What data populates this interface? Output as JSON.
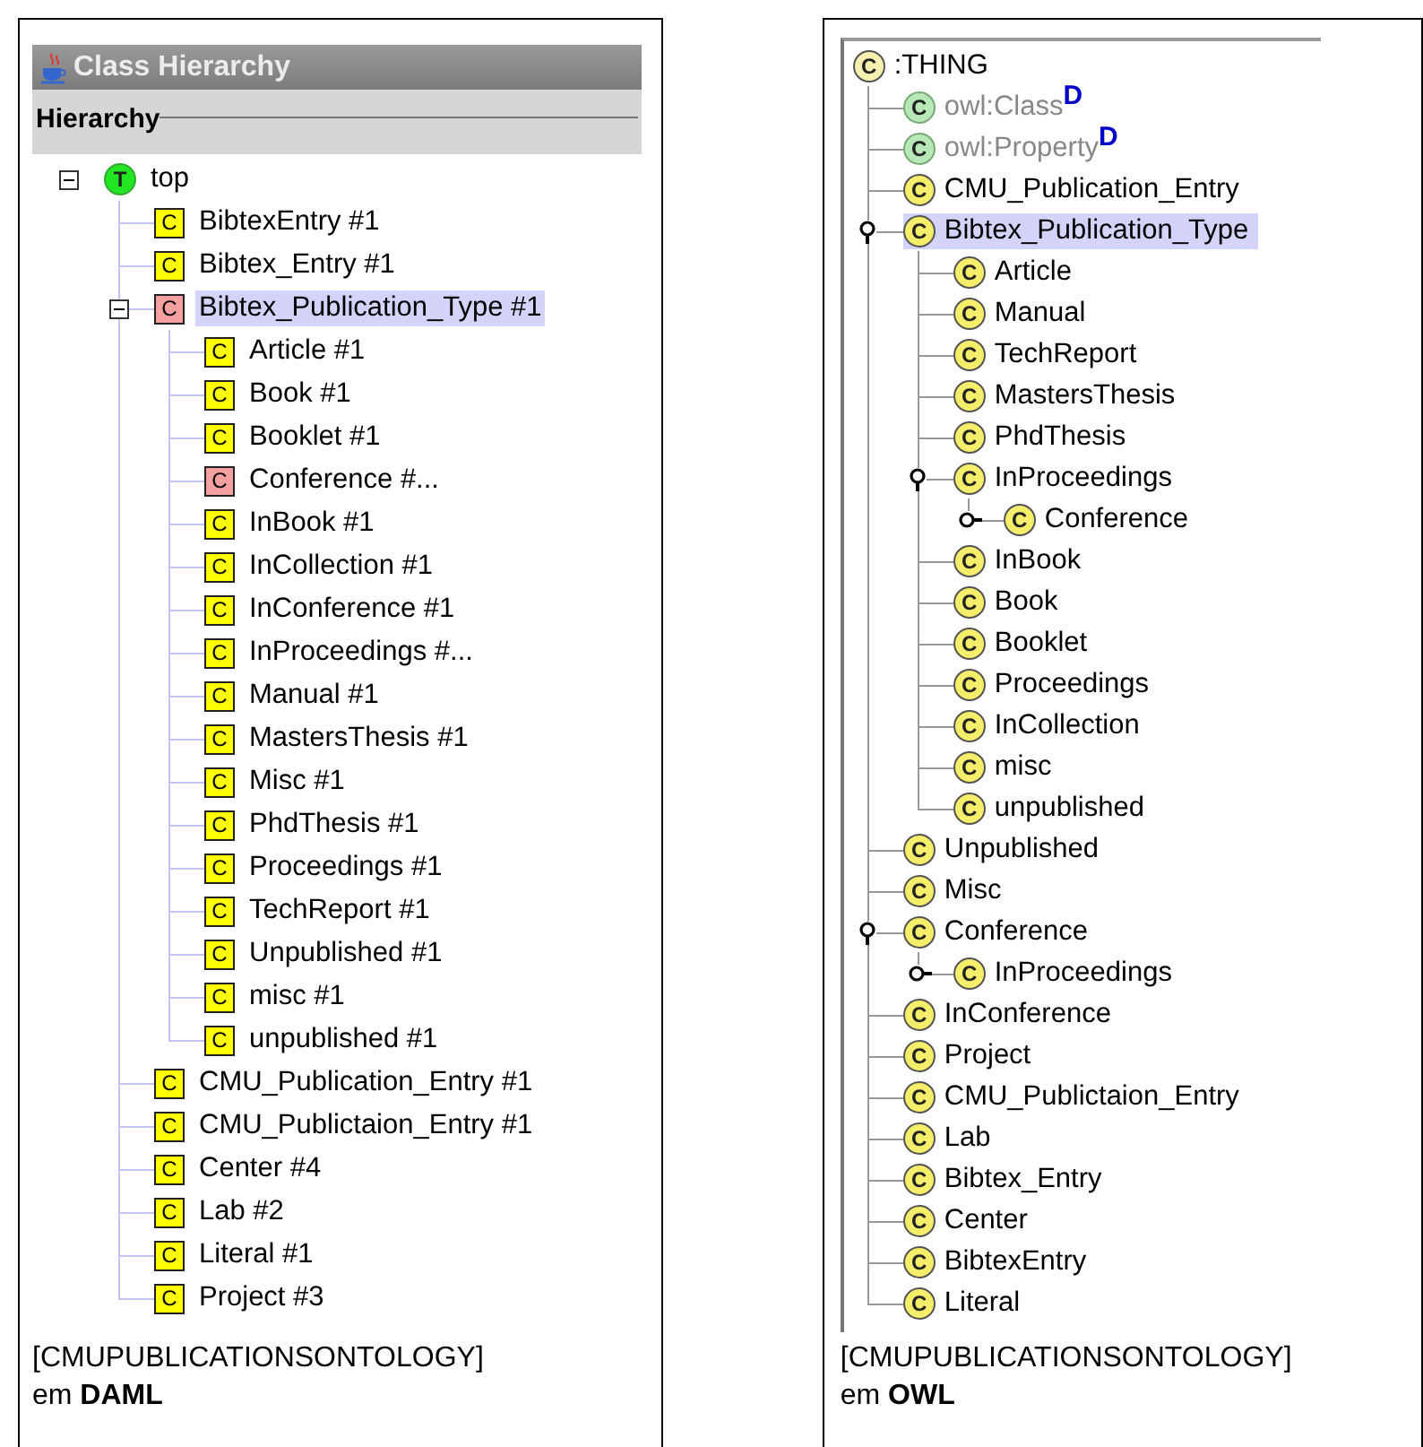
{
  "daml_panel": {
    "title": "Class Hierarchy",
    "tab_label": "Hierarchy",
    "tree": [
      {
        "label": "top",
        "icon_text": "T",
        "kind": "root",
        "selected": false,
        "expanded": true,
        "children": [
          {
            "label": "BibtexEntry #1",
            "icon_text": "C",
            "kind": "class",
            "selected": false
          },
          {
            "label": "Bibtex_Entry #1",
            "icon_text": "C",
            "kind": "class",
            "selected": false
          },
          {
            "label": "Bibtex_Publication_Type #1",
            "icon_text": "C",
            "kind": "flagged",
            "selected": true,
            "expanded": true,
            "children": [
              {
                "label": "Article #1",
                "icon_text": "C",
                "kind": "class",
                "selected": false
              },
              {
                "label": "Book #1",
                "icon_text": "C",
                "kind": "class",
                "selected": false
              },
              {
                "label": "Booklet #1",
                "icon_text": "C",
                "kind": "class",
                "selected": false
              },
              {
                "label": "Conference #...",
                "icon_text": "C",
                "kind": "flagged",
                "selected": false
              },
              {
                "label": "InBook #1",
                "icon_text": "C",
                "kind": "class",
                "selected": false
              },
              {
                "label": "InCollection #1",
                "icon_text": "C",
                "kind": "class",
                "selected": false
              },
              {
                "label": "InConference #1",
                "icon_text": "C",
                "kind": "class",
                "selected": false
              },
              {
                "label": "InProceedings #...",
                "icon_text": "C",
                "kind": "class",
                "selected": false
              },
              {
                "label": "Manual #1",
                "icon_text": "C",
                "kind": "class",
                "selected": false
              },
              {
                "label": "MastersThesis #1",
                "icon_text": "C",
                "kind": "class",
                "selected": false
              },
              {
                "label": "Misc #1",
                "icon_text": "C",
                "kind": "class",
                "selected": false
              },
              {
                "label": "PhdThesis #1",
                "icon_text": "C",
                "kind": "class",
                "selected": false
              },
              {
                "label": "Proceedings #1",
                "icon_text": "C",
                "kind": "class",
                "selected": false
              },
              {
                "label": "TechReport #1",
                "icon_text": "C",
                "kind": "class",
                "selected": false
              },
              {
                "label": "Unpublished #1",
                "icon_text": "C",
                "kind": "class",
                "selected": false
              },
              {
                "label": "misc #1",
                "icon_text": "C",
                "kind": "class",
                "selected": false
              },
              {
                "label": "unpublished #1",
                "icon_text": "C",
                "kind": "class",
                "selected": false
              }
            ]
          },
          {
            "label": "CMU_Publication_Entry #1",
            "icon_text": "C",
            "kind": "class",
            "selected": false
          },
          {
            "label": "CMU_Publictaion_Entry #1",
            "icon_text": "C",
            "kind": "class",
            "selected": false
          },
          {
            "label": "Center #4",
            "icon_text": "C",
            "kind": "class",
            "selected": false
          },
          {
            "label": "Lab #2",
            "icon_text": "C",
            "kind": "class",
            "selected": false
          },
          {
            "label": "Literal #1",
            "icon_text": "C",
            "kind": "class",
            "selected": false
          },
          {
            "label": "Project #3",
            "icon_text": "C",
            "kind": "class",
            "selected": false
          }
        ]
      }
    ],
    "caption": [
      "[CMUPUBLICATIONSONTOLOGY]",
      "em **DAML**"
    ]
  },
  "owl_panel": {
    "tree": [
      {
        "label": ":THING",
        "icon_text": "C",
        "kind": "root",
        "selected": false,
        "children": [
          {
            "label": "owl:Class$^{D}$",
            "icon_text": "C",
            "kind": "system",
            "selected": false
          },
          {
            "label": "owl:Property$^{D}$",
            "icon_text": "C",
            "kind": "system",
            "selected": false
          },
          {
            "label": "CMU_Publication_Entry",
            "icon_text": "C",
            "kind": "class",
            "selected": false
          },
          {
            "label": "Bibtex_Publication_Type",
            "icon_text": "C",
            "kind": "class",
            "selected": true,
            "expanded": true,
            "children": [
              {
                "label": "Article",
                "icon_text": "C",
                "kind": "class",
                "selected": false
              },
              {
                "label": "Manual",
                "icon_text": "C",
                "kind": "class",
                "selected": false
              },
              {
                "label": "TechReport",
                "icon_text": "C",
                "kind": "class",
                "selected": false
              },
              {
                "label": "MastersThesis",
                "icon_text": "C",
                "kind": "class",
                "selected": false
              },
              {
                "label": "PhdThesis",
                "icon_text": "C",
                "kind": "class",
                "selected": false
              },
              {
                "label": "InProceedings",
                "icon_text": "C",
                "kind": "class",
                "selected": false,
                "expanded": true,
                "children": [
                  {
                    "label": "Conference",
                    "icon_text": "C",
                    "kind": "class",
                    "selected": false,
                    "expanded": false
                  }
                ]
              },
              {
                "label": "InBook",
                "icon_text": "C",
                "kind": "class",
                "selected": false
              },
              {
                "label": "Book",
                "icon_text": "C",
                "kind": "class",
                "selected": false
              },
              {
                "label": "Booklet",
                "icon_text": "C",
                "kind": "class",
                "selected": false
              },
              {
                "label": "Proceedings",
                "icon_text": "C",
                "kind": "class",
                "selected": false
              },
              {
                "label": "InCollection",
                "icon_text": "C",
                "kind": "class",
                "selected": false
              },
              {
                "label": "misc",
                "icon_text": "C",
                "kind": "class",
                "selected": false
              },
              {
                "label": "unpublished",
                "icon_text": "C",
                "kind": "class",
                "selected": false
              }
            ]
          },
          {
            "label": "Unpublished",
            "icon_text": "C",
            "kind": "class",
            "selected": false
          },
          {
            "label": "Misc",
            "icon_text": "C",
            "kind": "class",
            "selected": false
          },
          {
            "label": "Conference",
            "icon_text": "C",
            "kind": "class",
            "selected": false,
            "expanded": true,
            "children": [
              {
                "label": "InProceedings",
                "icon_text": "C",
                "kind": "class",
                "selected": false,
                "expanded": false
              }
            ]
          },
          {
            "label": "InConference",
            "icon_text": "C",
            "kind": "class",
            "selected": false
          },
          {
            "label": "Project",
            "icon_text": "C",
            "kind": "class",
            "selected": false
          },
          {
            "label": "CMU_Publictaion_Entry",
            "icon_text": "C",
            "kind": "class",
            "selected": false
          },
          {
            "label": "Lab",
            "icon_text": "C",
            "kind": "class",
            "selected": false
          },
          {
            "label": "Bibtex_Entry",
            "icon_text": "C",
            "kind": "class",
            "selected": false
          },
          {
            "label": "Center",
            "icon_text": "C",
            "kind": "class",
            "selected": false
          },
          {
            "label": "BibtexEntry",
            "icon_text": "C",
            "kind": "class",
            "selected": false
          },
          {
            "label": "Literal",
            "icon_text": "C",
            "kind": "class",
            "selected": false
          }
        ]
      }
    ],
    "caption": [
      "[CMUPUBLICATIONSONTOLOGY]",
      "em **OWL**"
    ]
  }
}
